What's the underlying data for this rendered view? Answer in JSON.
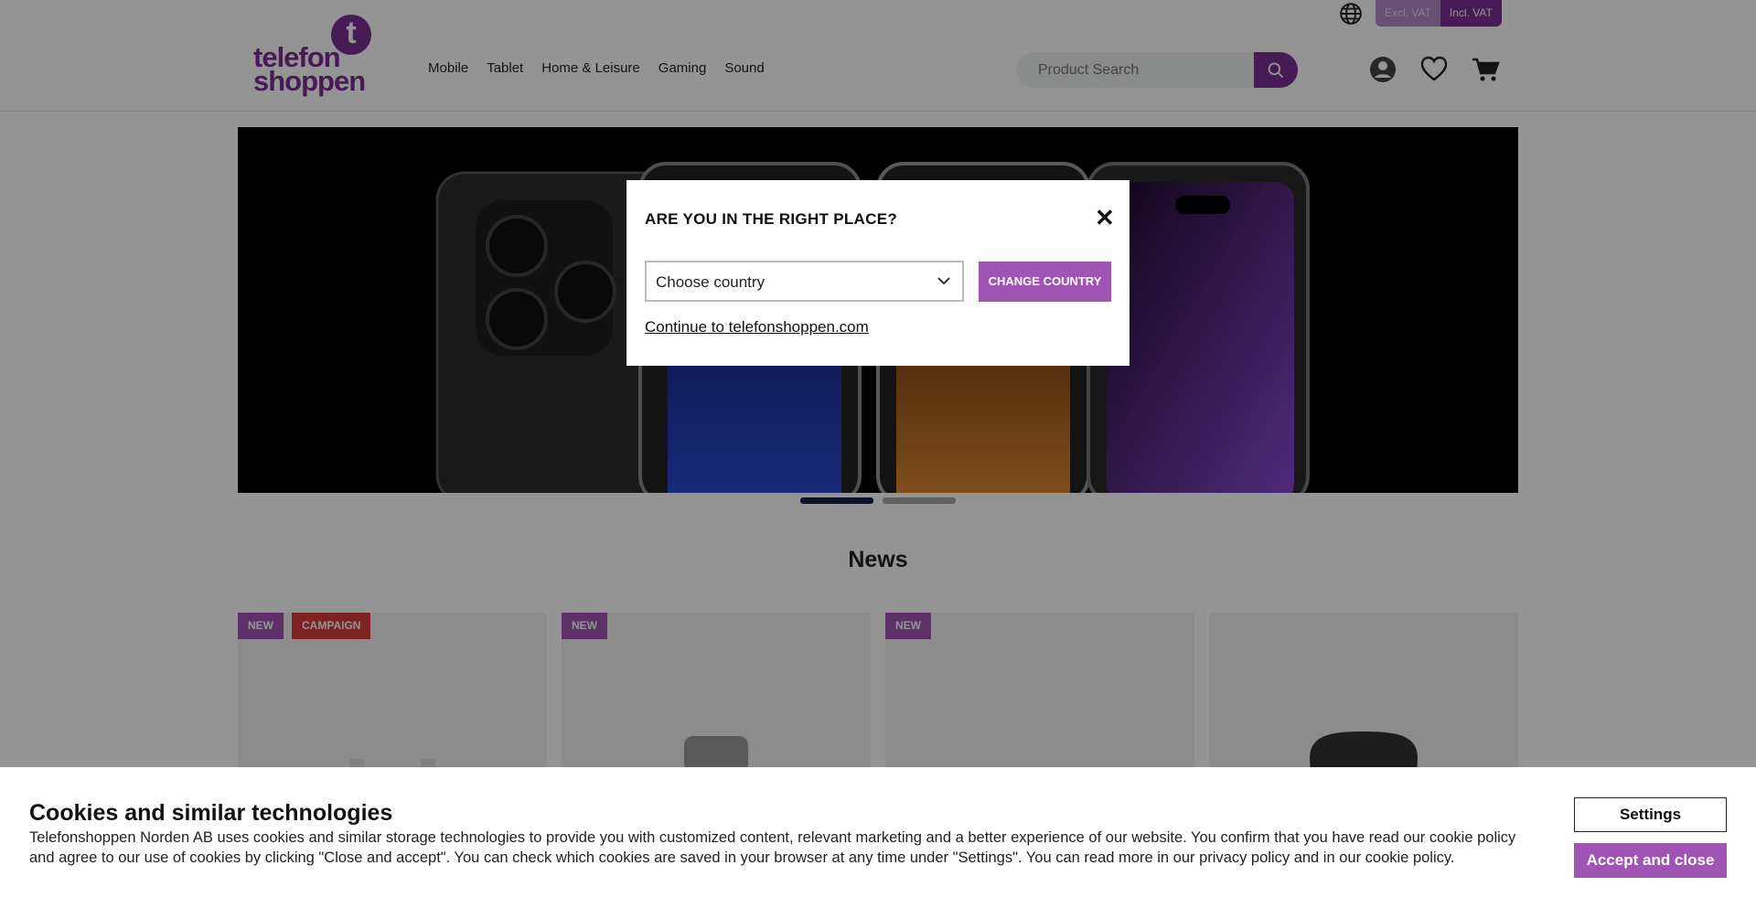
{
  "header": {
    "logo_letter": "t",
    "logo_line1": "telefon",
    "logo_line2": "shoppen",
    "nav": [
      "Mobile",
      "Tablet",
      "Home & Leisure",
      "Gaming",
      "Sound"
    ],
    "vat_excl": "Excl. VAT",
    "vat_incl": "Incl. VAT",
    "search_placeholder": "Product Search"
  },
  "section": {
    "title": "News"
  },
  "products": [
    {
      "badges": [
        "NEW",
        "CAMPAIGN"
      ]
    },
    {
      "badges": [
        "NEW"
      ]
    },
    {
      "badges": [
        "NEW"
      ]
    },
    {
      "badges": []
    }
  ],
  "modal": {
    "title": "ARE YOU IN THE RIGHT PLACE?",
    "close": "✕",
    "select_value": "Choose country",
    "change_button": "CHANGE COUNTRY",
    "continue_link": "Continue to telefonshoppen.com"
  },
  "cookie": {
    "title": "Cookies and similar technologies",
    "text": "Telefonshoppen Norden AB uses cookies and similar storage technologies to provide you with customized content, relevant marketing and a better experience of our website. You confirm that you have read our cookie policy and agree to our use of cookies by clicking \"Close and accept\". You can check which cookies are saved in your browser at any time under \"Settings\". You can read more in our privacy policy and in our cookie policy.",
    "settings_button": "Settings",
    "accept_button": "Accept and close"
  },
  "colors": {
    "brand": "#7a2f94",
    "accent": "#a055b4",
    "campaign": "#d93a3a"
  },
  "carousel": {
    "slides": 2,
    "active_slide": 1
  }
}
